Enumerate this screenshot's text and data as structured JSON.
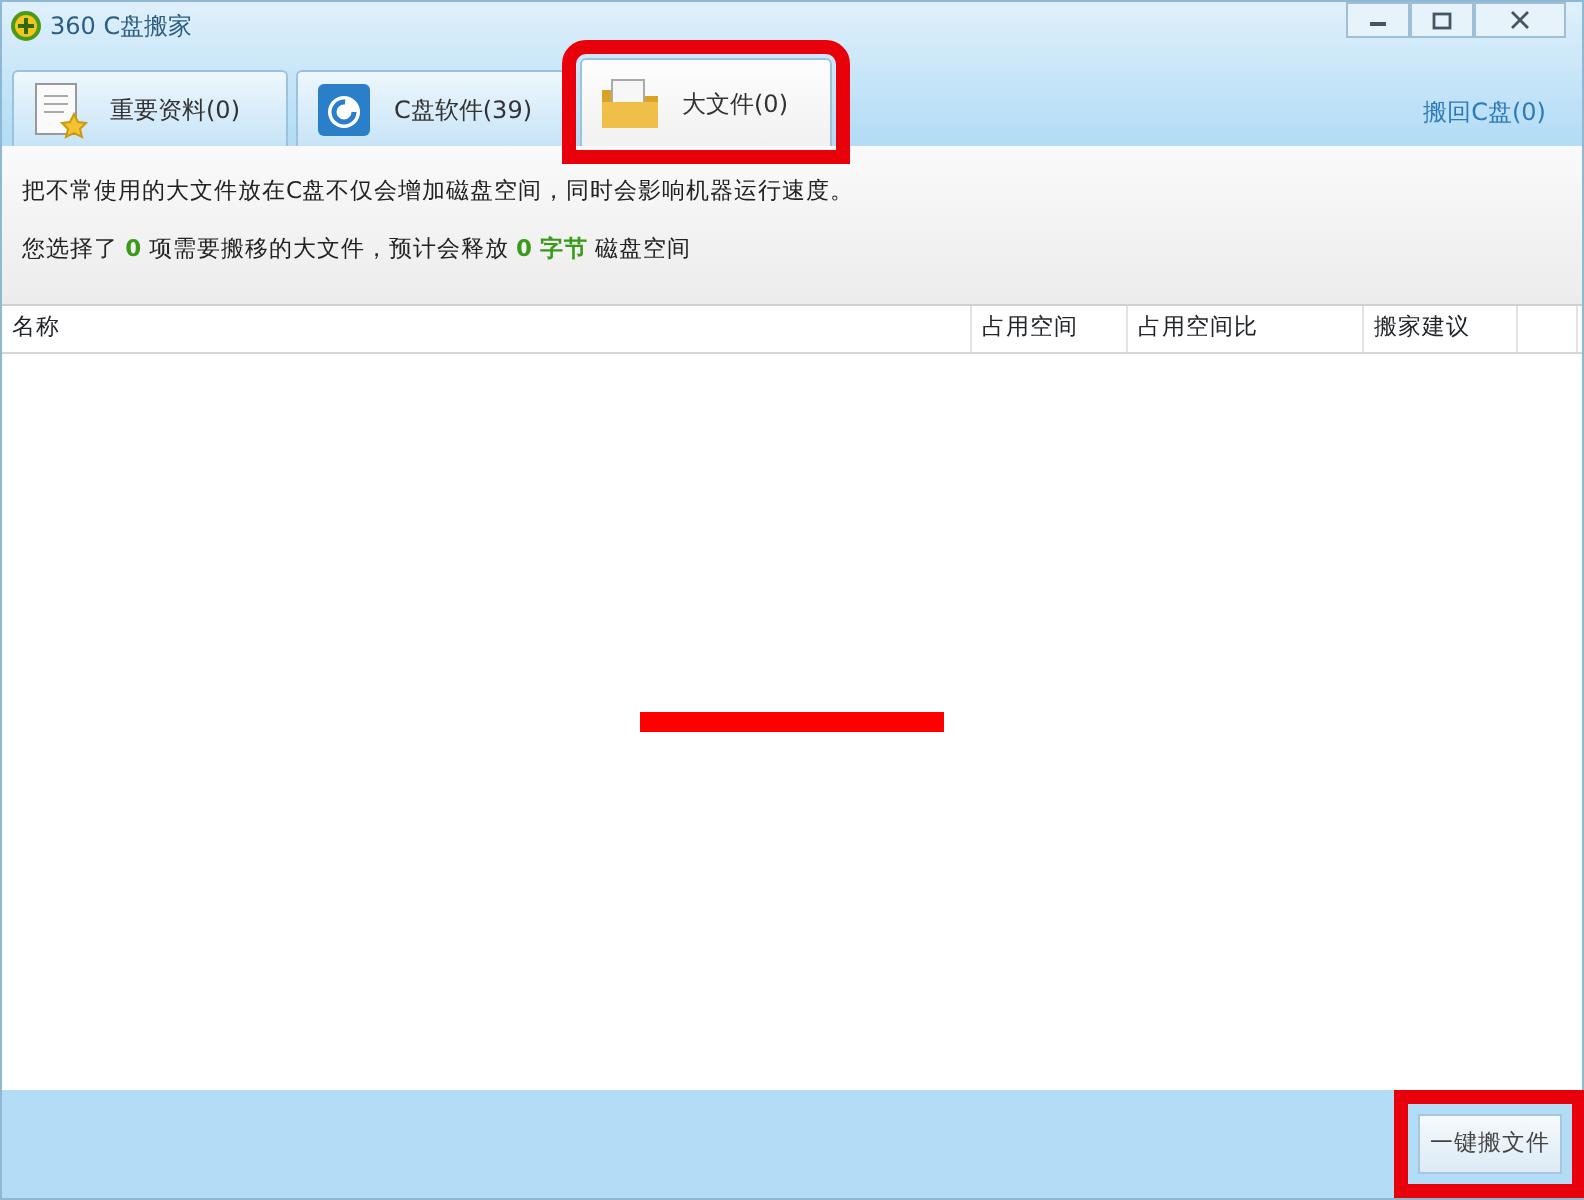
{
  "window": {
    "title": "360 C盘搬家"
  },
  "tabs": [
    {
      "label": "重要资料(0)",
      "kind": "document",
      "selected": false,
      "highlighted": false
    },
    {
      "label": "C盘软件(39)",
      "kind": "disk",
      "selected": false,
      "highlighted": false
    },
    {
      "label": "大文件(0)",
      "kind": "folder",
      "selected": true,
      "highlighted": true
    }
  ],
  "restore_link": "搬回C盘(0)",
  "info": {
    "description": "把不常使用的大文件放在C盘不仅会增加磁盘空间，同时会影响机器运行速度。",
    "summary": [
      {
        "text": "您选择了",
        "kind": "plain"
      },
      {
        "text": "0",
        "kind": "value"
      },
      {
        "text": "项需要搬移的大文件，预计会释放",
        "kind": "plain"
      },
      {
        "text": "0 字节",
        "kind": "value"
      },
      {
        "text": "磁盘空间",
        "kind": "plain"
      }
    ]
  },
  "table": {
    "columns": [
      "名称",
      "占用空间",
      "占用空间比",
      "搬家建议"
    ],
    "empty_message": {
      "redacted": true
    }
  },
  "move_button": {
    "label": "一键搬文件",
    "highlighted": true
  }
}
